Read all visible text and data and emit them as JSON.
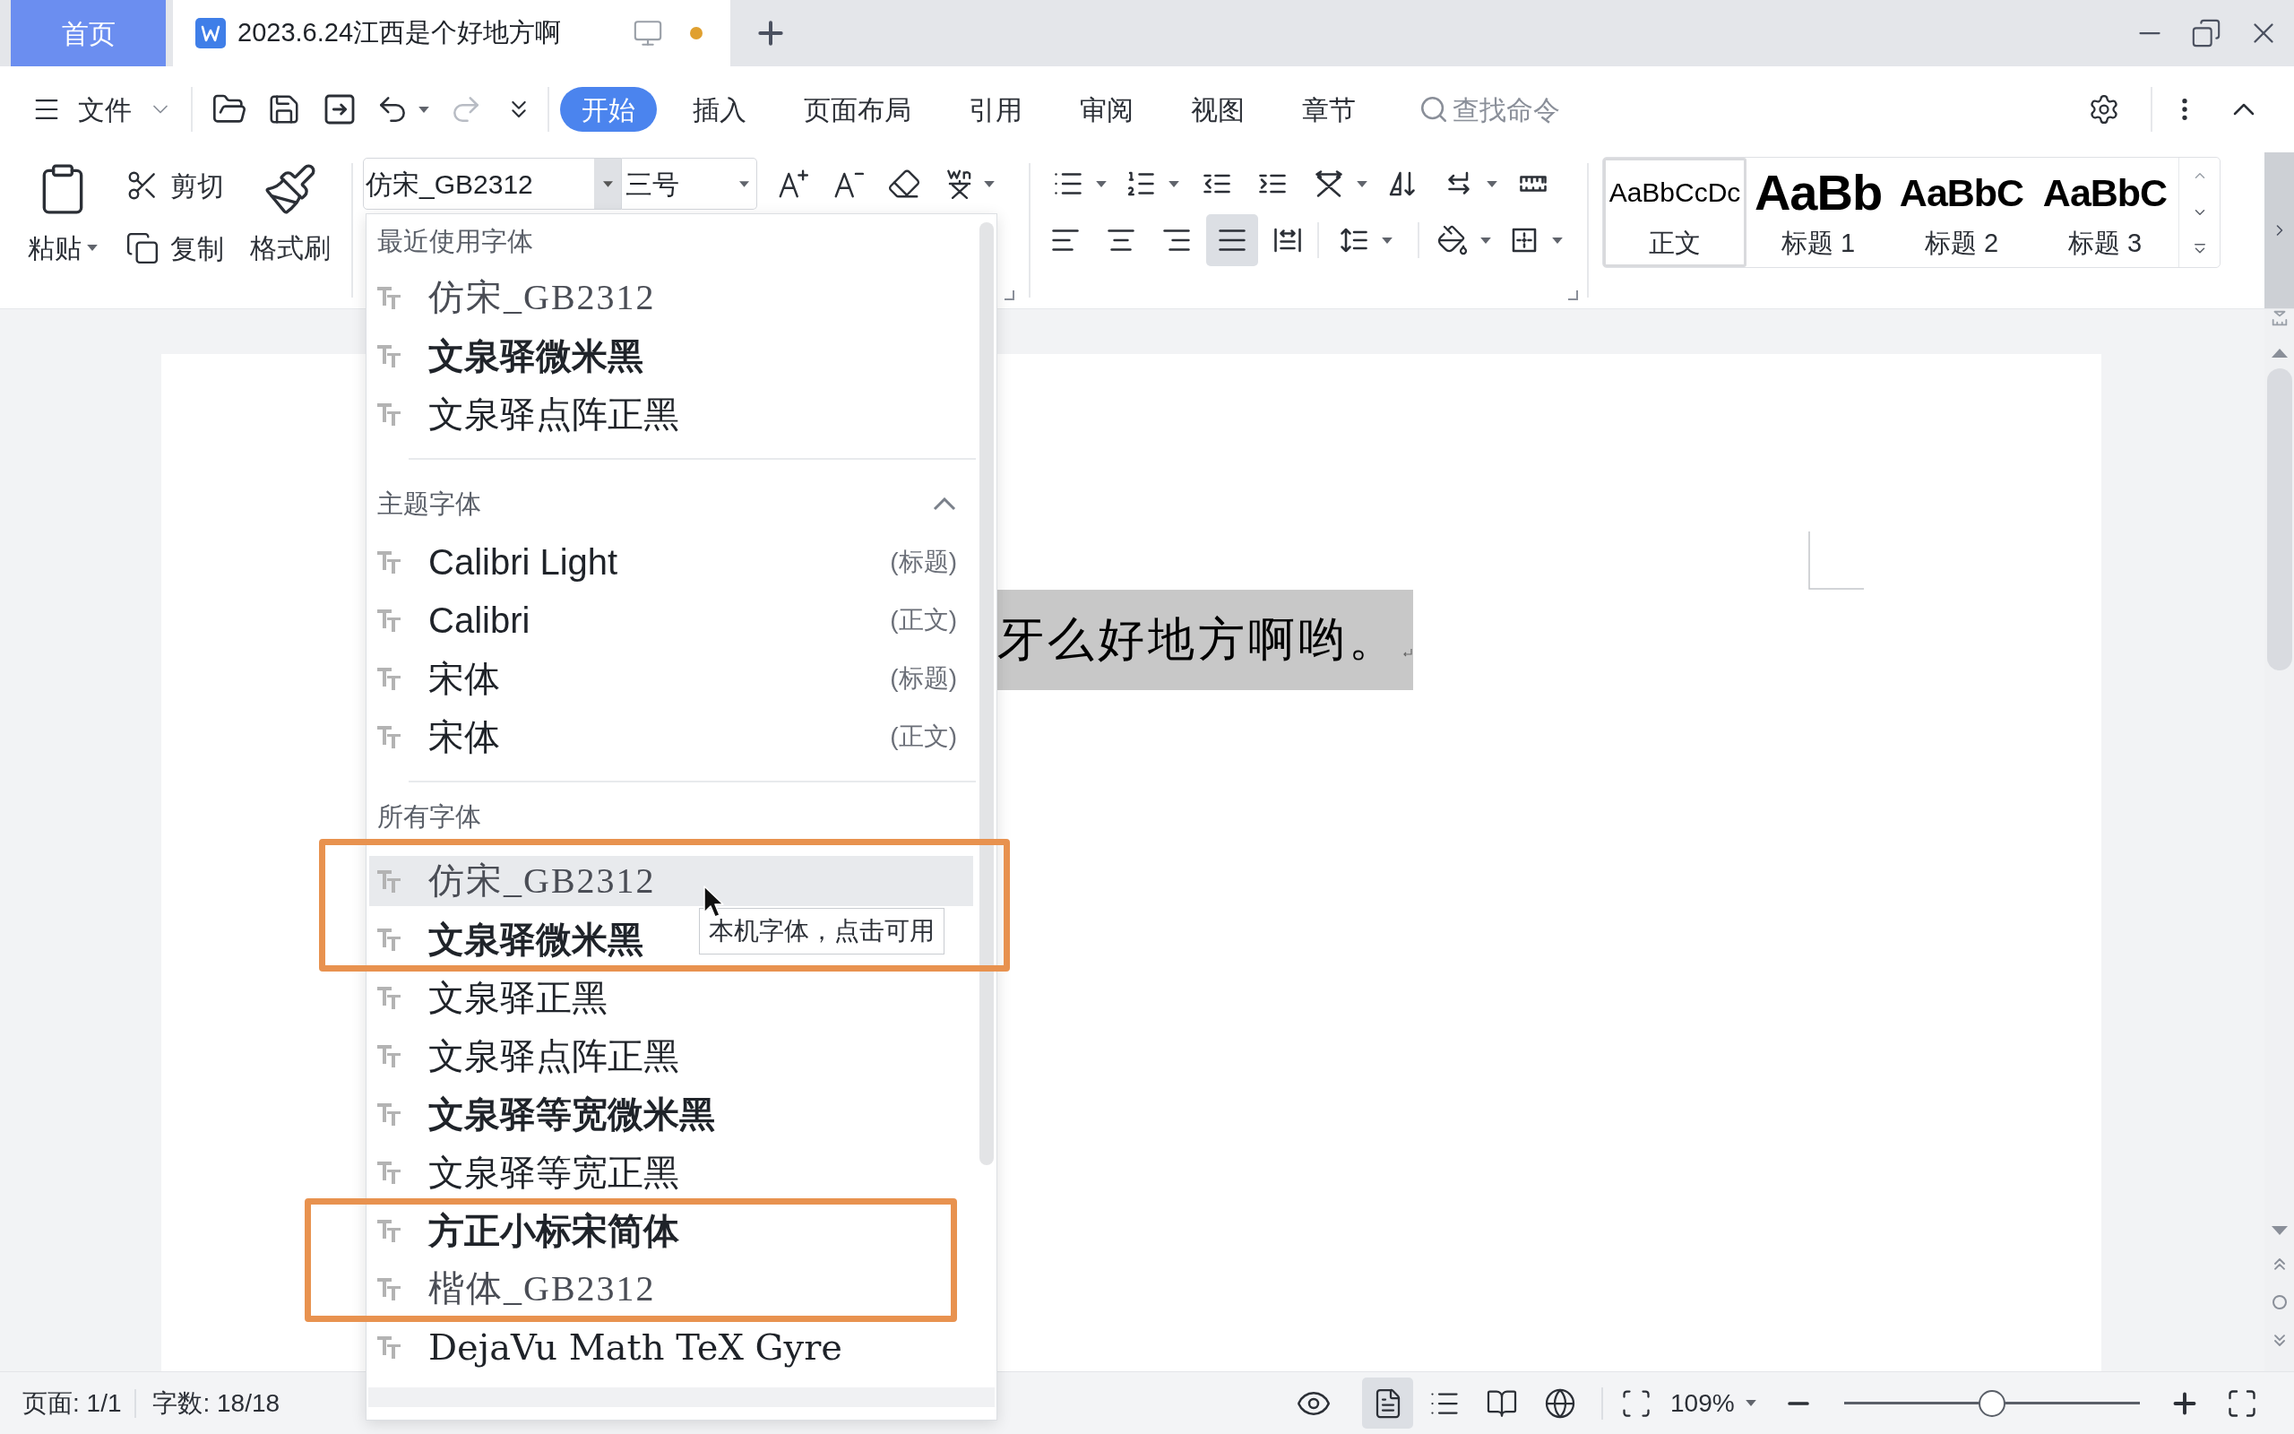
{
  "tabs": [
    {
      "label": "首页",
      "kind": "home",
      "selected": false
    },
    {
      "label": "2023.6.24江西是个好地方啊",
      "kind": "document",
      "selected": true,
      "modified": true
    }
  ],
  "menu": {
    "file": "文件",
    "ribbon_tabs": [
      {
        "label": "开始",
        "selected": true
      },
      {
        "label": "插入",
        "selected": false
      },
      {
        "label": "页面布局",
        "selected": false
      },
      {
        "label": "引用",
        "selected": false
      },
      {
        "label": "审阅",
        "selected": false
      },
      {
        "label": "视图",
        "selected": false
      },
      {
        "label": "章节",
        "selected": false
      }
    ],
    "search": {
      "placeholder": "查找命令"
    }
  },
  "ribbon": {
    "clipboard": {
      "paste": "粘贴",
      "cut": "剪切",
      "copy": "复制",
      "format_painter": "格式刷"
    },
    "font": {
      "name": "仿宋_GB2312",
      "size": "三号"
    },
    "alignment": [
      {
        "kind": "left",
        "selected": false
      },
      {
        "kind": "center",
        "selected": false
      },
      {
        "kind": "right",
        "selected": false
      },
      {
        "kind": "justify",
        "selected": true
      },
      {
        "kind": "distributed",
        "selected": false
      }
    ],
    "styles": [
      {
        "kind": "body",
        "preview": "AaBbCcDc",
        "label": "正文",
        "selected": true
      },
      {
        "kind": "heading1",
        "preview": "AaBb",
        "label": "标题 1",
        "selected": false
      },
      {
        "kind": "heading2",
        "preview": "AaBbC",
        "label": "标题 2",
        "selected": false
      },
      {
        "kind": "heading3",
        "preview": "AaBbC",
        "label": "标题 3",
        "selected": false
      }
    ]
  },
  "document": {
    "selected_text": "牙么好地方啊哟。"
  },
  "font_dropdown": {
    "sections": [
      {
        "title": "最近使用字体",
        "fonts": [
          {
            "name": "仿宋_GB2312",
            "kind": "fangsong"
          },
          {
            "name": "文泉驿微米黑",
            "kind": "bold"
          },
          {
            "name": "文泉驿点阵正黑",
            "kind": "regular"
          }
        ]
      },
      {
        "title": "主题字体",
        "expanded": true,
        "fonts": [
          {
            "name": "Calibri Light",
            "kind": "regular",
            "role": "(标题)"
          },
          {
            "name": "Calibri",
            "kind": "regular",
            "role": "(正文)"
          },
          {
            "name": "宋体",
            "kind": "regular",
            "role": "(标题)"
          },
          {
            "name": "宋体",
            "kind": "regular",
            "role": "(正文)"
          }
        ]
      },
      {
        "title": "所有字体",
        "fonts": [
          {
            "name": "仿宋_GB2312",
            "kind": "fangsong",
            "highlighted": true
          },
          {
            "name": "文泉驿微米黑",
            "kind": "bold",
            "highlighted": false
          },
          {
            "name": "文泉驿正黑",
            "kind": "regular",
            "highlighted": false
          },
          {
            "name": "文泉驿点阵正黑",
            "kind": "regular",
            "highlighted": false
          },
          {
            "name": "文泉驿等宽微米黑",
            "kind": "bold",
            "highlighted": false
          },
          {
            "name": "文泉驿等宽正黑",
            "kind": "regular",
            "highlighted": false
          },
          {
            "name": "方正小标宋简体",
            "kind": "serif_bold",
            "highlighted": false
          },
          {
            "name": "楷体_GB2312",
            "kind": "fangsong",
            "highlighted": false
          },
          {
            "name": "DejaVu Math TeX Gyre",
            "kind": "serif",
            "highlighted": false
          }
        ]
      }
    ],
    "tooltip": "本机字体，点击可用"
  },
  "status_bar": {
    "page": "页面: 1/1",
    "word_count": "字数: 18/18",
    "view_modes": [
      {
        "kind": "page",
        "selected": true
      },
      {
        "kind": "outline",
        "selected": false
      },
      {
        "kind": "reading",
        "selected": false
      },
      {
        "kind": "web",
        "selected": false
      }
    ],
    "zoom": "109%",
    "zoom_slider": {
      "level": 0.5
    }
  }
}
